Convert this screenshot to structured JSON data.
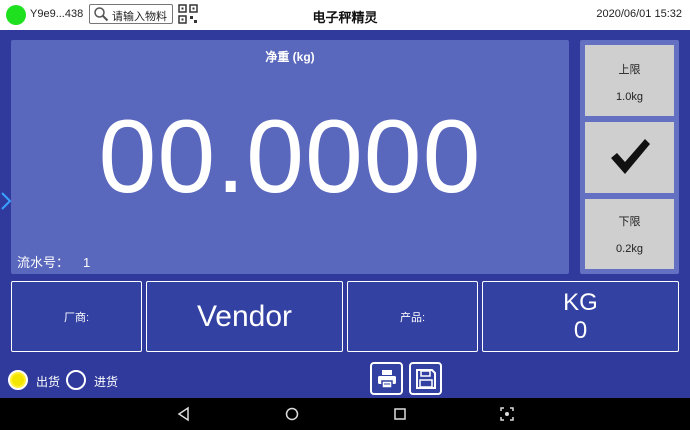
{
  "topbar": {
    "status_color": "#1fe01f",
    "device_id": "Y9e9...438",
    "search_placeholder": "请输入物料",
    "search_icon": "search-icon",
    "qr_icon": "qr-code-icon",
    "title": "电子秤精灵",
    "datetime": "2020/06/01 15:32"
  },
  "weight": {
    "label": "净重 (kg)",
    "value": "00.0000",
    "serial_label": "流水号：",
    "serial_value": "1"
  },
  "limits": {
    "upper_label": "上限",
    "upper_value": "1.0kg",
    "confirm_icon": "checkmark-icon",
    "lower_label": "下限",
    "lower_value": "0.2kg"
  },
  "info": {
    "vendor_label": "厂商:",
    "vendor_value": "Vendor",
    "product_label": "产品:",
    "unit_label": "KG",
    "unit_value": "0"
  },
  "controls": {
    "radio_out_label": "出货",
    "radio_in_label": "进货",
    "selected": "出货",
    "print_icon": "printer-icon",
    "save_icon": "save-icon"
  },
  "colors": {
    "background": "#2f3a9c",
    "weight_panel": "#5967bd",
    "limit_button": "#cfcfcf",
    "radio_selected": "#f2e600"
  }
}
